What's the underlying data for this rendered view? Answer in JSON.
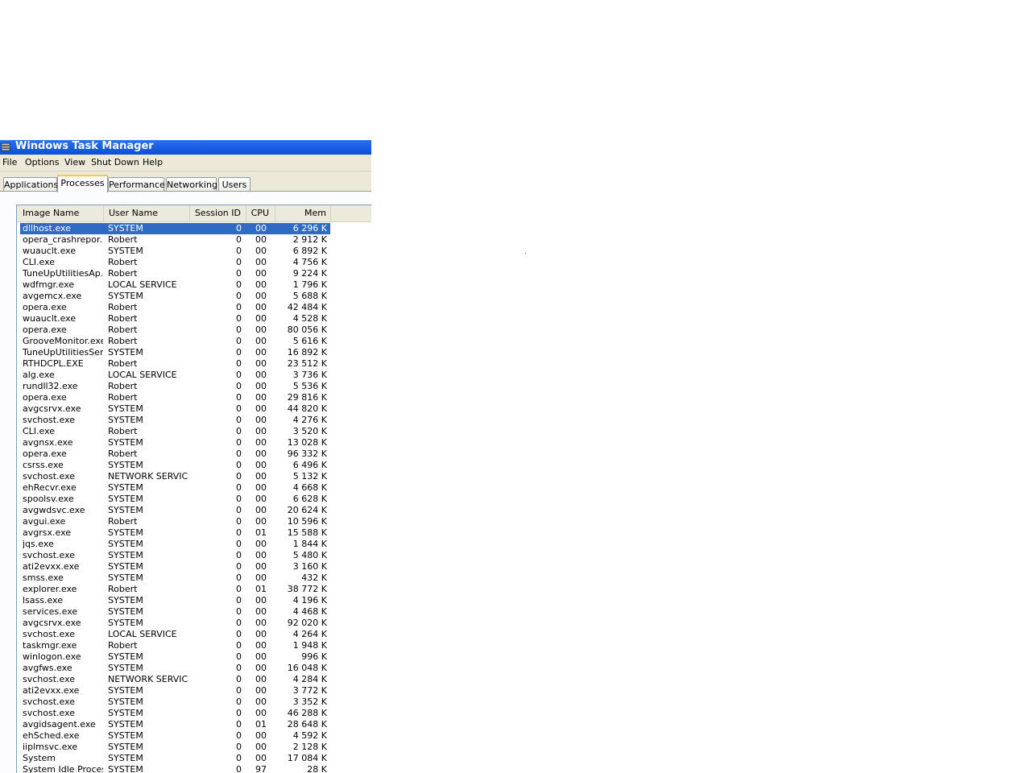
{
  "window": {
    "title": "Windows Task Manager",
    "title_icon": "task-manager-icon"
  },
  "menu": [
    "File",
    "Options",
    "View",
    "Shut Down",
    "Help"
  ],
  "tabs": [
    "Applications",
    "Processes",
    "Performance",
    "Networking",
    "Users"
  ],
  "active_tab": "Processes",
  "columns": [
    "Image Name",
    "User Name",
    "Session ID",
    "CPU",
    "Mem Usage"
  ],
  "selected_row": 0,
  "rows": [
    [
      "dllhost.exe",
      "SYSTEM",
      "0",
      "00",
      "6 296 K"
    ],
    [
      "opera_crashrepor...",
      "Robert",
      "0",
      "00",
      "2 912 K"
    ],
    [
      "wuauclt.exe",
      "SYSTEM",
      "0",
      "00",
      "6 892 K"
    ],
    [
      "CLI.exe",
      "Robert",
      "0",
      "00",
      "4 756 K"
    ],
    [
      "TuneUpUtilitiesAp...",
      "Robert",
      "0",
      "00",
      "9 224 K"
    ],
    [
      "wdfmgr.exe",
      "LOCAL SERVICE",
      "0",
      "00",
      "1 796 K"
    ],
    [
      "avgemcx.exe",
      "SYSTEM",
      "0",
      "00",
      "5 688 K"
    ],
    [
      "opera.exe",
      "Robert",
      "0",
      "00",
      "42 484 K"
    ],
    [
      "wuauclt.exe",
      "Robert",
      "0",
      "00",
      "4 528 K"
    ],
    [
      "opera.exe",
      "Robert",
      "0",
      "00",
      "80 056 K"
    ],
    [
      "GrooveMonitor.exe",
      "Robert",
      "0",
      "00",
      "5 616 K"
    ],
    [
      "TuneUpUtilitiesSer...",
      "SYSTEM",
      "0",
      "00",
      "16 892 K"
    ],
    [
      "RTHDCPL.EXE",
      "Robert",
      "0",
      "00",
      "23 512 K"
    ],
    [
      "alg.exe",
      "LOCAL SERVICE",
      "0",
      "00",
      "3 736 K"
    ],
    [
      "rundll32.exe",
      "Robert",
      "0",
      "00",
      "5 536 K"
    ],
    [
      "opera.exe",
      "Robert",
      "0",
      "00",
      "29 816 K"
    ],
    [
      "avgcsrvx.exe",
      "SYSTEM",
      "0",
      "00",
      "44 820 K"
    ],
    [
      "svchost.exe",
      "SYSTEM",
      "0",
      "00",
      "4 276 K"
    ],
    [
      "CLI.exe",
      "Robert",
      "0",
      "00",
      "3 520 K"
    ],
    [
      "avgnsx.exe",
      "SYSTEM",
      "0",
      "00",
      "13 028 K"
    ],
    [
      "opera.exe",
      "Robert",
      "0",
      "00",
      "96 332 K"
    ],
    [
      "csrss.exe",
      "SYSTEM",
      "0",
      "00",
      "6 496 K"
    ],
    [
      "svchost.exe",
      "NETWORK SERVICE",
      "0",
      "00",
      "5 132 K"
    ],
    [
      "ehRecvr.exe",
      "SYSTEM",
      "0",
      "00",
      "4 668 K"
    ],
    [
      "spoolsv.exe",
      "SYSTEM",
      "0",
      "00",
      "6 628 K"
    ],
    [
      "avgwdsvc.exe",
      "SYSTEM",
      "0",
      "00",
      "20 624 K"
    ],
    [
      "avgui.exe",
      "Robert",
      "0",
      "00",
      "10 596 K"
    ],
    [
      "avgrsx.exe",
      "SYSTEM",
      "0",
      "01",
      "15 588 K"
    ],
    [
      "jqs.exe",
      "SYSTEM",
      "0",
      "00",
      "1 844 K"
    ],
    [
      "svchost.exe",
      "SYSTEM",
      "0",
      "00",
      "5 480 K"
    ],
    [
      "ati2evxx.exe",
      "SYSTEM",
      "0",
      "00",
      "3 160 K"
    ],
    [
      "smss.exe",
      "SYSTEM",
      "0",
      "00",
      "432 K"
    ],
    [
      "explorer.exe",
      "Robert",
      "0",
      "01",
      "38 772 K"
    ],
    [
      "lsass.exe",
      "SYSTEM",
      "0",
      "00",
      "4 196 K"
    ],
    [
      "services.exe",
      "SYSTEM",
      "0",
      "00",
      "4 468 K"
    ],
    [
      "avgcsrvx.exe",
      "SYSTEM",
      "0",
      "00",
      "92 020 K"
    ],
    [
      "svchost.exe",
      "LOCAL SERVICE",
      "0",
      "00",
      "4 264 K"
    ],
    [
      "taskmgr.exe",
      "Robert",
      "0",
      "00",
      "1 948 K"
    ],
    [
      "winlogon.exe",
      "SYSTEM",
      "0",
      "00",
      "996 K"
    ],
    [
      "avgfws.exe",
      "SYSTEM",
      "0",
      "00",
      "16 048 K"
    ],
    [
      "svchost.exe",
      "NETWORK SERVICE",
      "0",
      "00",
      "4 284 K"
    ],
    [
      "ati2evxx.exe",
      "SYSTEM",
      "0",
      "00",
      "3 772 K"
    ],
    [
      "svchost.exe",
      "SYSTEM",
      "0",
      "00",
      "3 352 K"
    ],
    [
      "svchost.exe",
      "SYSTEM",
      "0",
      "00",
      "46 288 K"
    ],
    [
      "avgidsagent.exe",
      "SYSTEM",
      "0",
      "01",
      "28 648 K"
    ],
    [
      "ehSched.exe",
      "SYSTEM",
      "0",
      "00",
      "4 592 K"
    ],
    [
      "iiplmsvc.exe",
      "SYSTEM",
      "0",
      "00",
      "2 128 K"
    ],
    [
      "System",
      "SYSTEM",
      "0",
      "00",
      "17 084 K"
    ],
    [
      "System Idle Process",
      "SYSTEM",
      "0",
      "97",
      "28 K"
    ]
  ],
  "colors": {
    "titlebar": "#0a4fd8",
    "selection": "#316ac5",
    "window_bg": "#ece9d8",
    "active_tab_accent": "#ffc83c"
  }
}
